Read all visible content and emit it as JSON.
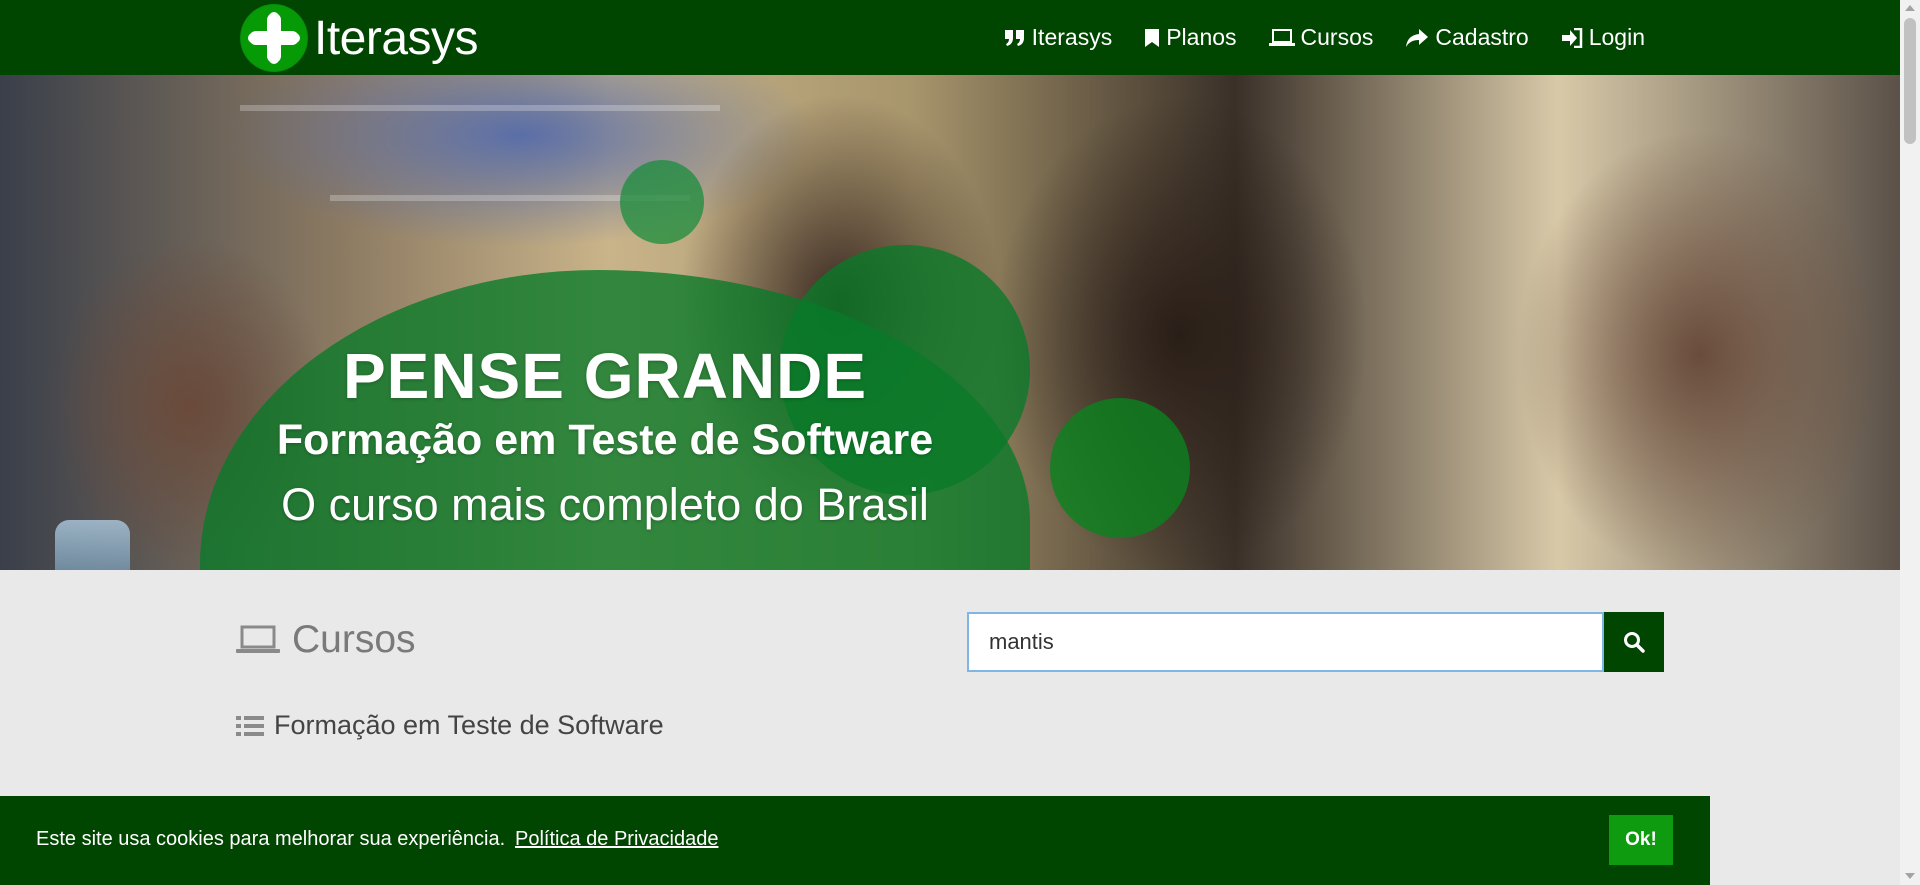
{
  "brand": {
    "name": "Iterasys",
    "logo_icon": "plus-cross-logo-icon"
  },
  "nav": {
    "items": [
      {
        "label": "Iterasys",
        "icon": "quote-icon"
      },
      {
        "label": "Planos",
        "icon": "bookmark-icon"
      },
      {
        "label": "Cursos",
        "icon": "laptop-icon"
      },
      {
        "label": "Cadastro",
        "icon": "share-arrow-icon"
      },
      {
        "label": "Login",
        "icon": "sign-in-icon"
      }
    ]
  },
  "hero": {
    "title": "PENSE GRANDE",
    "subtitle": "Formação em Teste de Software",
    "tagline": "O curso mais completo do Brasil"
  },
  "courses": {
    "title": "Cursos",
    "icon": "laptop-icon",
    "search_value": "mantis",
    "search_button_icon": "search-icon",
    "items": [
      {
        "label": "Formação em Teste de Software",
        "icon": "list-icon"
      }
    ]
  },
  "cookie_bar": {
    "message": "Este site usa cookies para melhorar sua experiência.",
    "link": "Política de Privacidade",
    "ok": "Ok!"
  },
  "colors": {
    "nav_bg": "#004500",
    "accent_green": "#0f9b0f",
    "page_bg": "#e9e9e9"
  }
}
